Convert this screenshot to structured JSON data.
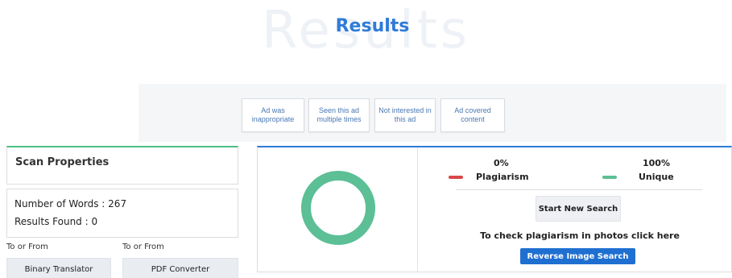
{
  "header": {
    "watermark": "Results",
    "title": "Results"
  },
  "ads": {
    "options": [
      "Ad was inappropriate",
      "Seen this ad multiple times",
      "Not interested in this ad",
      "Ad covered content"
    ]
  },
  "scan": {
    "title": "Scan Properties",
    "words_label": "Number of Words : 267",
    "results_label": "Results Found : 0"
  },
  "tools": [
    {
      "caption": "To or From",
      "label": "Binary Translator"
    },
    {
      "caption": "To or From",
      "label": "PDF Converter"
    }
  ],
  "result": {
    "plagiarism_pct": "0%",
    "unique_pct": "100%",
    "plagiarism_label": "Plagiarism",
    "unique_label": "Unique",
    "plagiarism_fraction": 0,
    "unique_fraction": 1,
    "colors": {
      "plagiarism": "#d9464a",
      "unique": "#5cbf95"
    },
    "start_button": "Start New Search",
    "photo_text": "To check plagiarism in photos click here",
    "reverse_button": "Reverse Image Search"
  }
}
